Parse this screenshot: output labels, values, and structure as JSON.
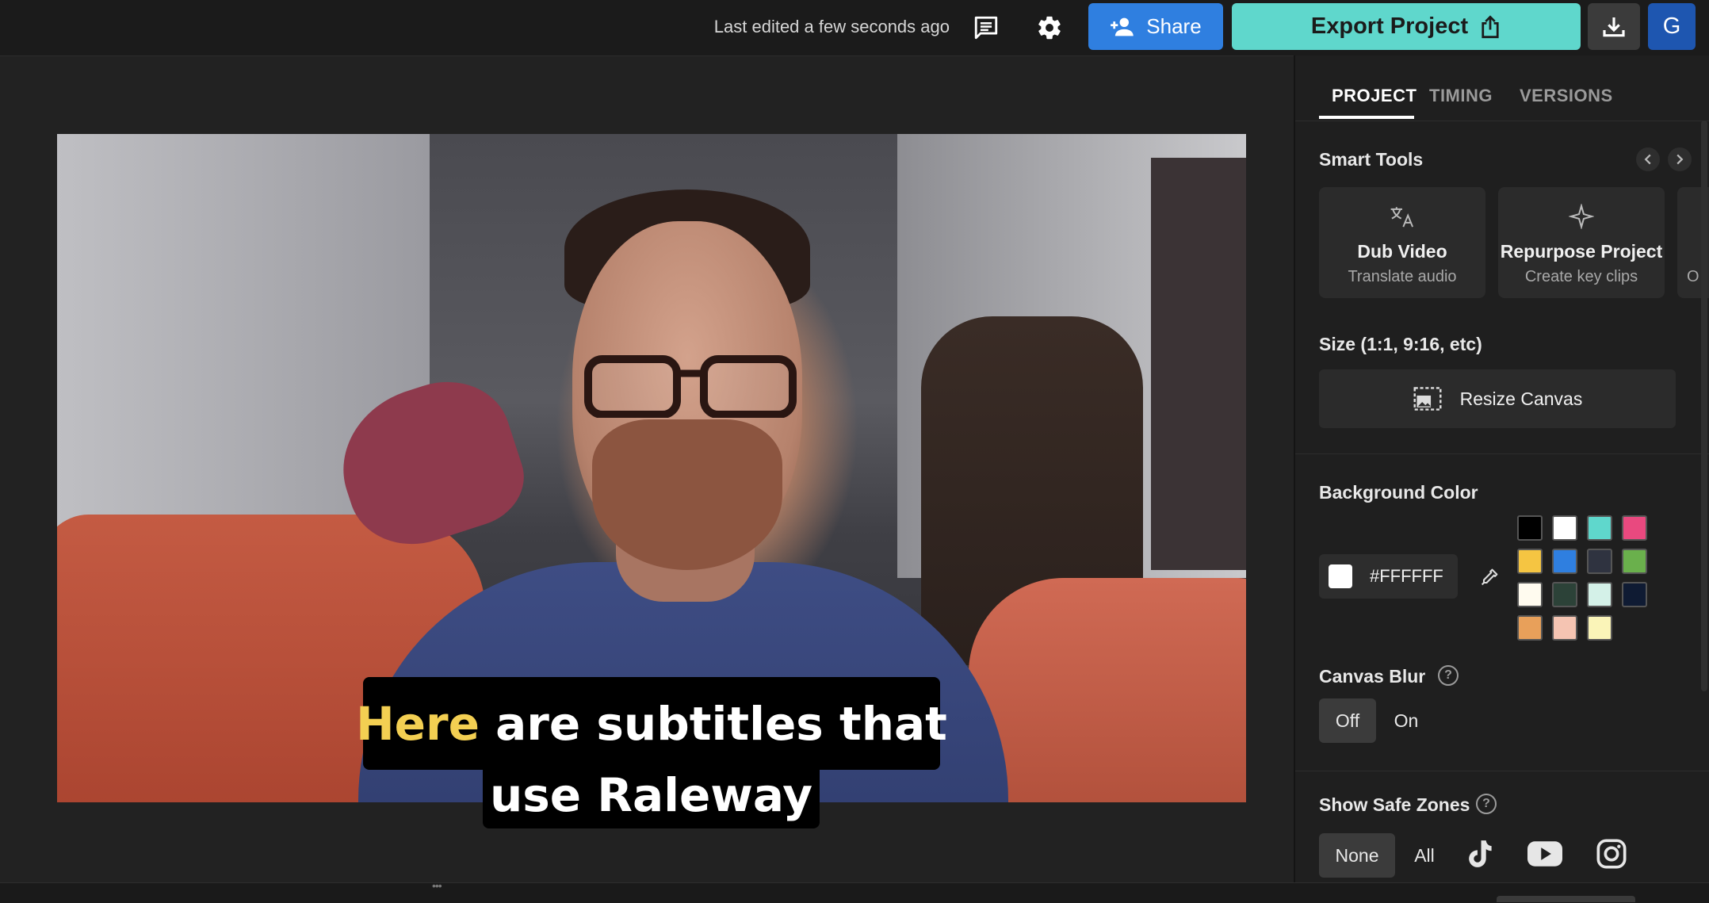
{
  "topbar": {
    "last_edited": "Last edited a few seconds ago",
    "share_label": "Share",
    "export_label": "Export Project",
    "avatar_initial": "G"
  },
  "video": {
    "subtitle_highlight": "Here",
    "subtitle_line1_rest": " are subtitles that",
    "subtitle_line2": "use Raleway",
    "highlight_color": "#F3CF52"
  },
  "panel": {
    "tabs": [
      {
        "label": "PROJECT",
        "active": true
      },
      {
        "label": "TIMING",
        "active": false
      },
      {
        "label": "VERSIONS",
        "active": false
      }
    ],
    "smart_tools": {
      "title": "Smart Tools",
      "cards": [
        {
          "title": "Dub Video",
          "subtitle": "Translate audio",
          "icon": "translate-icon"
        },
        {
          "title": "Repurpose Project",
          "subtitle": "Create key clips",
          "icon": "sparkle-icon"
        },
        {
          "title": "",
          "subtitle": "O",
          "icon": ""
        }
      ]
    },
    "size": {
      "title": "Size (1:1, 9:16, etc)",
      "resize_label": "Resize Canvas"
    },
    "background": {
      "title": "Background Color",
      "hex_value": "#FFFFFF",
      "swatches": [
        "#000000",
        "#FFFFFF",
        "#5FD7CC",
        "#E9497F",
        "#F5C542",
        "#2F7FE0",
        "#2F3340",
        "#6AB04C",
        "#FFFBEF",
        "#2C4238",
        "#D4F1E8",
        "#0F1B33",
        "#E8A05A",
        "#F5C4B2",
        "#FAF4B8"
      ]
    },
    "canvas_blur": {
      "title": "Canvas Blur",
      "off_label": "Off",
      "on_label": "On",
      "value": "Off"
    },
    "safe_zones": {
      "title": "Show Safe Zones",
      "none_label": "None",
      "all_label": "All",
      "selected": "None",
      "platforms": [
        "tiktok-icon",
        "youtube-icon",
        "instagram-icon"
      ]
    }
  },
  "colors": {
    "share_bg": "#2F7FE0",
    "export_bg": "#5FD7CC",
    "avatar_bg": "#1E56B0"
  }
}
